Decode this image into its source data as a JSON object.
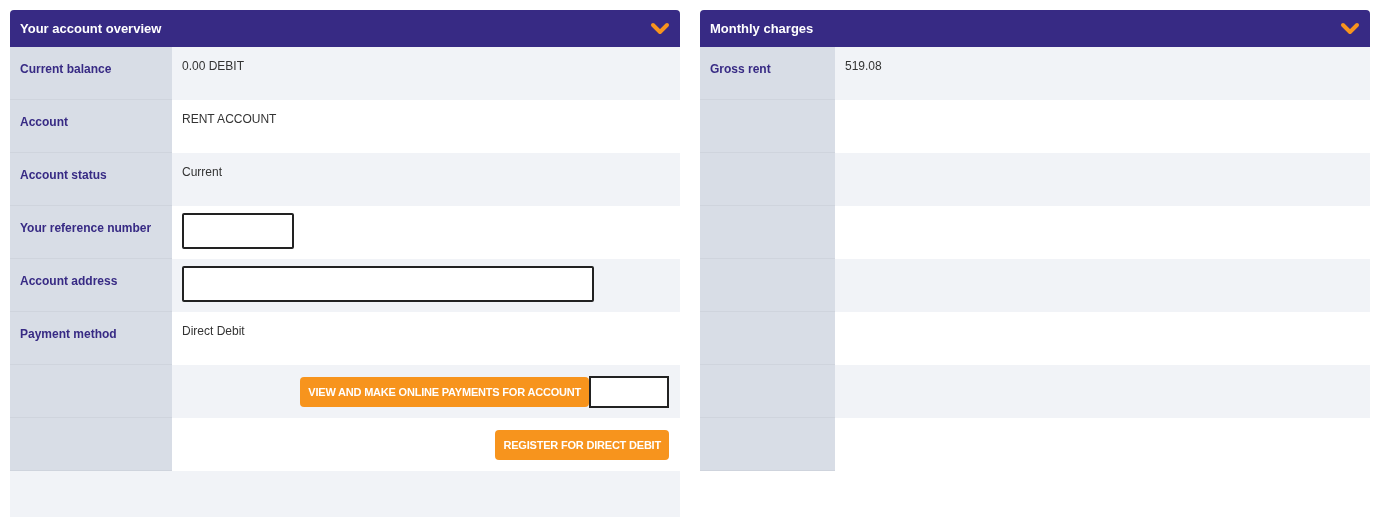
{
  "panels": [
    {
      "title": "Your account overview",
      "expanded": true,
      "rows": [
        {
          "kind": "text",
          "label": "Current balance",
          "value": "0.00 DEBIT"
        },
        {
          "kind": "text",
          "label": "Account",
          "value": "RENT ACCOUNT"
        },
        {
          "kind": "text",
          "label": "Account status",
          "value": "Current"
        },
        {
          "kind": "shortblank",
          "label": "Your reference number"
        },
        {
          "kind": "longblank",
          "label": "Account address"
        },
        {
          "kind": "text",
          "label": "Payment method",
          "value": "Direct Debit"
        },
        {
          "kind": "button",
          "text": "VIEW AND MAKE ONLINE PAYMENTS FOR ACCOUNT",
          "redacted": true
        },
        {
          "kind": "button",
          "text": "REGISTER FOR DIRECT DEBIT",
          "redacted": false
        }
      ]
    },
    {
      "title": "Monthly charges",
      "expanded": true,
      "rows": [
        {
          "kind": "text",
          "label": "Gross rent",
          "value": "519.08"
        },
        {
          "kind": "empty"
        },
        {
          "kind": "empty"
        },
        {
          "kind": "empty"
        },
        {
          "kind": "empty"
        },
        {
          "kind": "empty"
        },
        {
          "kind": "empty"
        },
        {
          "kind": "empty"
        }
      ]
    }
  ]
}
